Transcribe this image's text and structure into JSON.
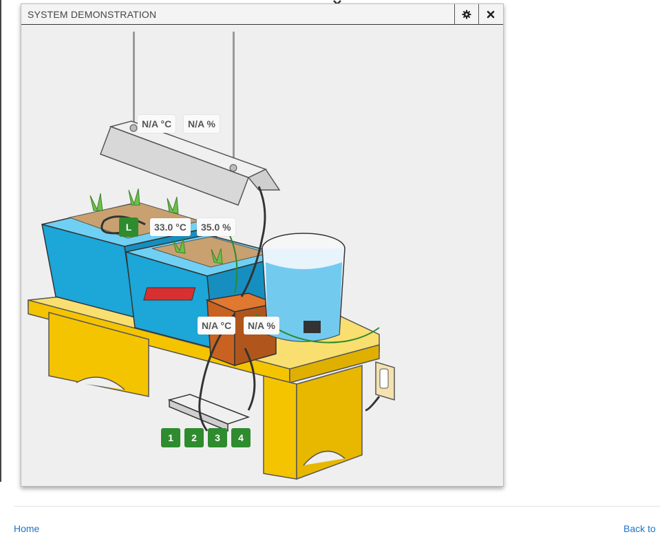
{
  "window": {
    "title": "SYSTEM DEMONSTRATION",
    "icons": {
      "settings": "gear-icon",
      "close": "close-icon"
    }
  },
  "sensors": {
    "light_temp": "N/A °C",
    "light_humidity": "N/A %",
    "grow_temp": "33.0 °C",
    "grow_humidity": "35.0 %",
    "box_temp": "N/A °C",
    "box_humidity": "N/A %"
  },
  "light_indicator": "L",
  "outlets": [
    "1",
    "2",
    "3",
    "4"
  ],
  "colors": {
    "accent_green": "#2e8b2e",
    "tub_blue": "#2aa6d8",
    "table_yellow": "#f5c400",
    "link_blue": "#1a73c8"
  },
  "footer": {
    "home": "Home",
    "back": "Back to"
  }
}
